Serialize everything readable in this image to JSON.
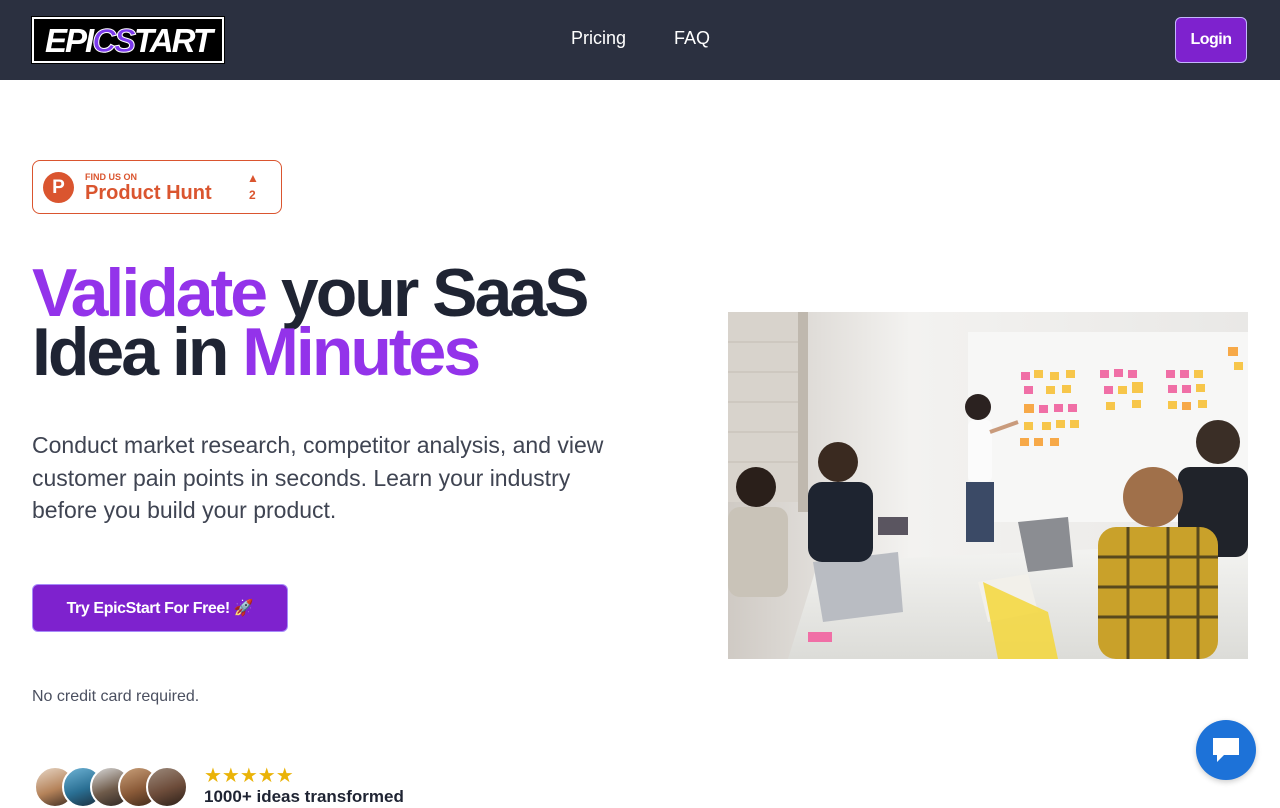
{
  "header": {
    "logo_prefix": "EPI",
    "logo_accent": "CS",
    "logo_suffix": "TART",
    "nav": [
      "Pricing",
      "FAQ"
    ],
    "login_label": "Login"
  },
  "product_hunt": {
    "small": "FIND US ON",
    "big": "Product Hunt",
    "upvotes": "2",
    "badge_letter": "P"
  },
  "hero": {
    "headline_part1": "Validate",
    "headline_part2": " your SaaS",
    "headline_part3": "Idea in ",
    "headline_part4": "Minutes",
    "subtitle": "Conduct market research, competitor analysis, and view customer pain points in seconds. Learn your industry before you build your product.",
    "cta_label": "Try EpicStart For Free! 🚀",
    "note": "No credit card required."
  },
  "social_proof": {
    "stars": "★★★★★",
    "rating": 5,
    "caption": "1000+ ideas transformed"
  },
  "colors": {
    "nav_bg": "#2b3040",
    "accent": "#9333ea",
    "button": "#7e22ce",
    "product_hunt": "#da552f",
    "chat": "#1d72d8",
    "star": "#eab308"
  },
  "icons": {
    "chat": "chat-bubble-icon",
    "upvote": "upvote-triangle-icon",
    "stars": "star-icon"
  }
}
